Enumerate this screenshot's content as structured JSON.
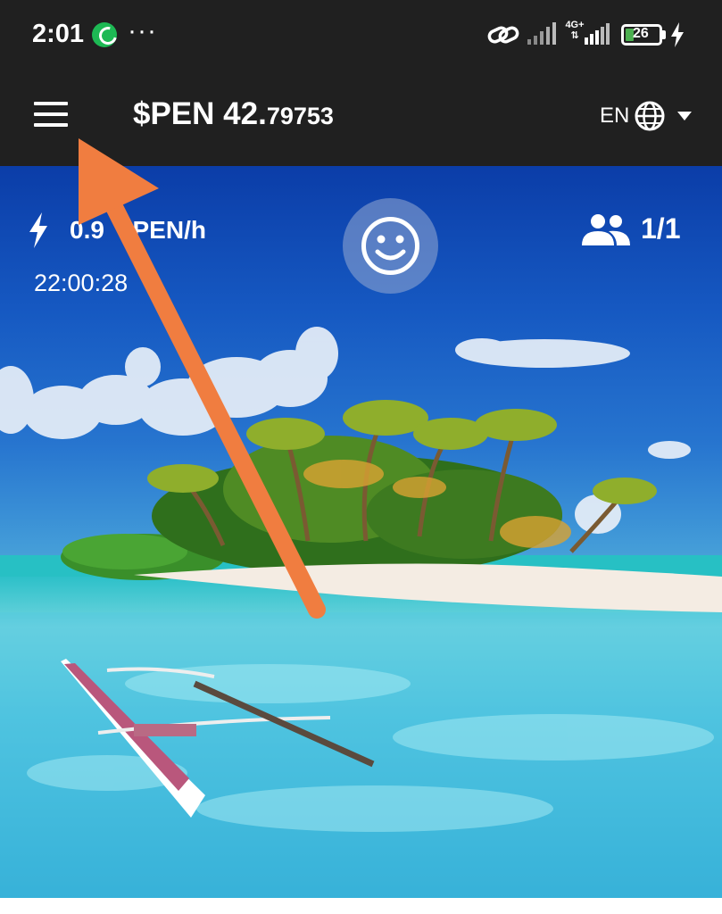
{
  "status_bar": {
    "time": "2:01",
    "more_indicator": "···",
    "network_type": "4G+",
    "battery_level": "26",
    "icons": [
      "whatsapp-icon",
      "link-icon",
      "signal-icon",
      "signal-icon",
      "battery-icon",
      "charging-icon"
    ]
  },
  "header": {
    "balance_main": "$PEN 42.",
    "balance_decimals": "79753",
    "language": "EN",
    "icons": [
      "menu-icon",
      "globe-icon",
      "dropdown-icon"
    ]
  },
  "hero": {
    "rate_value": "0.9",
    "rate_unit": "$PEN/h",
    "timer": "22:00:28",
    "referrals": "1/1",
    "icons": [
      "bolt-icon",
      "smiley-icon",
      "people-icon"
    ]
  },
  "colors": {
    "bar_background": "#202020",
    "arrow": "#f07d40",
    "battery_green": "#4caf50",
    "whatsapp_green": "#1db954"
  }
}
